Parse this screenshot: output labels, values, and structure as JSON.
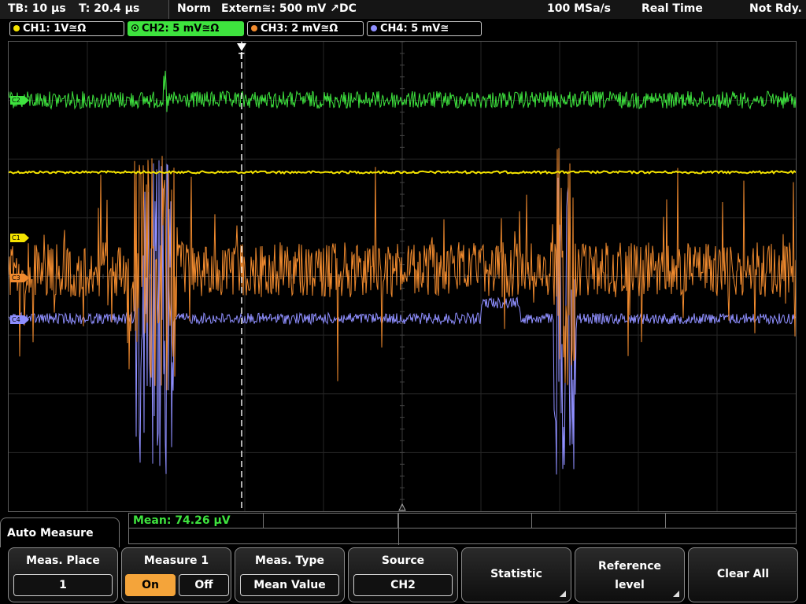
{
  "status": {
    "timebase": "TB: 10 µs",
    "trigger_time": "T: 20.4 µs",
    "mode": "Norm",
    "trigger": "Extern≅: 500 mV ↗DC",
    "sample_rate": "100 MSa/s",
    "acq_mode": "Real Time",
    "state": "Not Rdy."
  },
  "channels": [
    {
      "label": "CH1: 1V≅Ω",
      "color": "#f5e400",
      "active": false
    },
    {
      "label": "CH2: 5 mV≅Ω",
      "color": "#3ee33e",
      "active": true
    },
    {
      "label": "CH3: 2 mV≅Ω",
      "color": "#f08a2e",
      "active": false
    },
    {
      "label": "CH4: 5 mV≅",
      "color": "#8f8fff",
      "active": false
    }
  ],
  "markers": {
    "c1": "C1",
    "c2": "C2",
    "c3": "C3",
    "c4": "C4",
    "trigger": "T"
  },
  "measurement": {
    "result": "Mean: 74.26 µV"
  },
  "menu": {
    "title": "Auto Measure"
  },
  "softkeys": {
    "meas_place": {
      "label": "Meas. Place",
      "value": "1"
    },
    "measure1": {
      "label": "Measure 1",
      "on": "On",
      "off": "Off",
      "state": "On"
    },
    "meas_type": {
      "label": "Meas. Type",
      "value": "Mean Value"
    },
    "source": {
      "label": "Source",
      "value": "CH2"
    },
    "statistic": {
      "label": "Statistic"
    },
    "reference": {
      "label1": "Reference",
      "label2": "level"
    },
    "clear_all": {
      "label": "Clear All"
    }
  }
}
